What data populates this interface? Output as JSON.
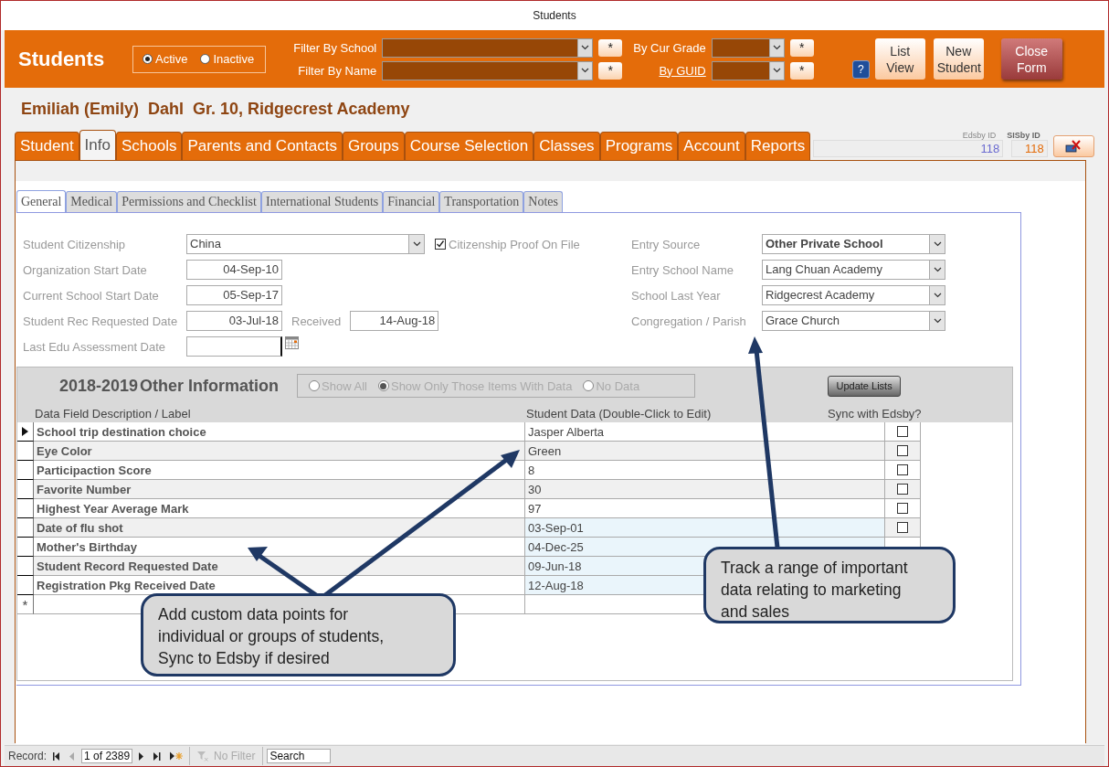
{
  "window": {
    "title": "Students"
  },
  "header": {
    "title": "Students",
    "status_options": [
      {
        "label": "Active",
        "selected": true
      },
      {
        "label": "Inactive",
        "selected": false
      }
    ],
    "filter_groups": [
      {
        "fields": [
          {
            "label": "Filter By School",
            "kind": "label",
            "clear": "*"
          },
          {
            "label": "Filter By Name",
            "kind": "label",
            "clear": "*"
          }
        ]
      },
      {
        "fields": [
          {
            "label": "By Cur Grade",
            "kind": "label",
            "clear": "*"
          },
          {
            "label": "By GUID",
            "kind": "link",
            "clear": "*"
          }
        ]
      }
    ],
    "help": "?",
    "buttons": [
      {
        "label": "List View",
        "kind": "light"
      },
      {
        "label": "New Student",
        "kind": "light"
      },
      {
        "label": "Close Form",
        "kind": "dark"
      }
    ]
  },
  "student_heading": "Emiliah (Emily)  Dahl  Gr. 10, Ridgecrest Academy",
  "tabs": [
    {
      "label": "Student",
      "selected": false
    },
    {
      "label": "Info",
      "selected": true
    },
    {
      "label": "Schools",
      "selected": false
    },
    {
      "label": "Parents and Contacts",
      "selected": false
    },
    {
      "label": "Groups",
      "selected": false
    },
    {
      "label": "Course Selection",
      "selected": false
    },
    {
      "label": "Classes",
      "selected": false
    },
    {
      "label": "Programs",
      "selected": false
    },
    {
      "label": "Account",
      "selected": false
    },
    {
      "label": "Reports",
      "selected": false
    }
  ],
  "ids": {
    "edsby_label": "Edsby ID",
    "edsby_value": "118",
    "sisby_label": "SISby ID",
    "sisby_value": "118"
  },
  "subtabs": [
    {
      "label": "General",
      "selected": true
    },
    {
      "label": "Medical",
      "selected": false
    },
    {
      "label": "Permissions and Checklist",
      "selected": false
    },
    {
      "label": "International Students",
      "selected": false
    },
    {
      "label": "Financial",
      "selected": false
    },
    {
      "label": "Transportation",
      "selected": false
    },
    {
      "label": "Notes",
      "selected": false
    }
  ],
  "general": {
    "citizenship": {
      "label": "Student Citizenship",
      "value": "China"
    },
    "citizenship_proof": {
      "label": "Citizenship Proof On File",
      "checked": true
    },
    "dates": [
      {
        "label": "Organization Start Date",
        "value": "04-Sep-10"
      },
      {
        "label": "Current  School Start Date",
        "value": "05-Sep-17"
      },
      {
        "label": "Student Rec Requested Date",
        "value": "03-Jul-18",
        "extra": {
          "label": "Received",
          "value": "14-Aug-18"
        }
      },
      {
        "label": "Last Edu Assessment Date",
        "picker": true
      }
    ],
    "combos": [
      {
        "label": "Entry Source",
        "value": "Other Private School",
        "emphasized": true
      },
      {
        "label": "Entry School Name",
        "value": "Lang Chuan Academy",
        "emphasized": false
      },
      {
        "label": "School Last Year",
        "value": "Ridgecrest Academy",
        "emphasized": false
      },
      {
        "label": "Congregation / Parish",
        "value": "Grace Church",
        "emphasized": false
      }
    ]
  },
  "other_info": {
    "year": "2018-2019",
    "title": "Other Information",
    "filter_options": [
      {
        "label": "Show All",
        "selected": false
      },
      {
        "label": "Show Only Those Items With Data",
        "selected": true
      },
      {
        "label": "No Data",
        "selected": false
      }
    ],
    "update_button": "Update Lists",
    "columns": [
      "Data Field Description / Label",
      "Student Data (Double-Click to Edit)",
      "Sync with Edsby?"
    ],
    "rows": [
      {
        "label": "School trip destination choice",
        "value": "Jasper Alberta",
        "kind": "text",
        "current": true,
        "synced": false
      },
      {
        "label": "Eye Color",
        "value": "Green",
        "kind": "text",
        "current": false,
        "synced": false
      },
      {
        "label": "Participaction Score",
        "value": "8",
        "kind": "text",
        "current": false,
        "synced": false
      },
      {
        "label": "Favorite Number",
        "value": "30",
        "kind": "text",
        "current": false,
        "synced": false
      },
      {
        "label": "Highest Year Average Mark",
        "value": "97",
        "kind": "text",
        "current": false,
        "synced": false
      },
      {
        "label": "Date of flu shot",
        "value": "03-Sep-01",
        "kind": "date",
        "current": false,
        "synced": false
      },
      {
        "label": "Mother's Birthday",
        "value": "04-Dec-25",
        "kind": "date",
        "current": false
      },
      {
        "label": "Student Record Requested Date",
        "value": "09-Jun-18",
        "kind": "date",
        "current": false
      },
      {
        "label": "Registration Pkg Received Date",
        "value": "12-Aug-18",
        "kind": "date",
        "current": false
      }
    ],
    "new_row_marker": "*"
  },
  "callouts": [
    {
      "text": "Add custom data points for individual or groups of students, Sync to Edsby if desired"
    },
    {
      "text": "Track a range of important data relating to marketing and sales"
    }
  ],
  "record_bar": {
    "label": "Record:",
    "position": "1 of 2389",
    "filter": "No Filter",
    "search_placeholder": "Search"
  }
}
